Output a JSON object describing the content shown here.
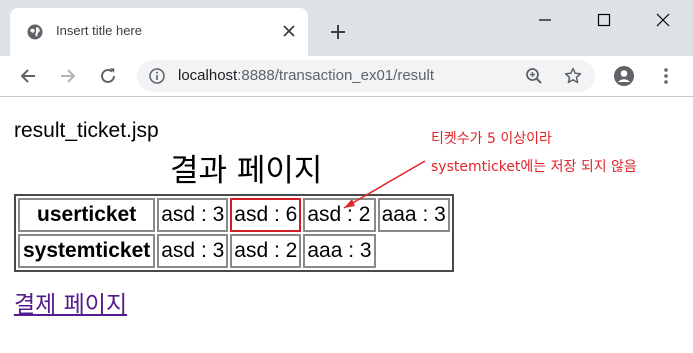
{
  "browser": {
    "tab_title": "Insert title here",
    "address_host": "localhost",
    "address_path": ":8888/transaction_ex01/result"
  },
  "page": {
    "file_name": "result_ticket.jsp",
    "heading": "결과 페이지",
    "tickets": {
      "rows": [
        {
          "header": "userticket",
          "cells": [
            "asd : 3",
            "asd : 6",
            "asd : 2",
            "aaa : 3"
          ],
          "highlight_index": 1
        },
        {
          "header": "systemticket",
          "cells": [
            "asd : 3",
            "asd : 2",
            "aaa : 3"
          ]
        }
      ]
    },
    "payment_link": "결제 페이지",
    "annotation": {
      "line1": "티켓수가 5 이상이라",
      "line2": "systemticket에는 저장 되지 않음",
      "color": "#e0242a"
    }
  },
  "icons": {
    "favicon": "globe-icon",
    "tab_close": "close-icon",
    "new_tab": "plus-icon",
    "minimize": "minimize-icon",
    "maximize": "maximize-icon",
    "close_window": "close-icon",
    "back": "back-arrow-icon",
    "forward": "forward-arrow-icon",
    "reload": "reload-icon",
    "site_info": "info-icon",
    "zoom": "zoom-icon",
    "bookmark": "star-icon",
    "profile": "profile-icon",
    "menu": "more-vert-icon"
  }
}
